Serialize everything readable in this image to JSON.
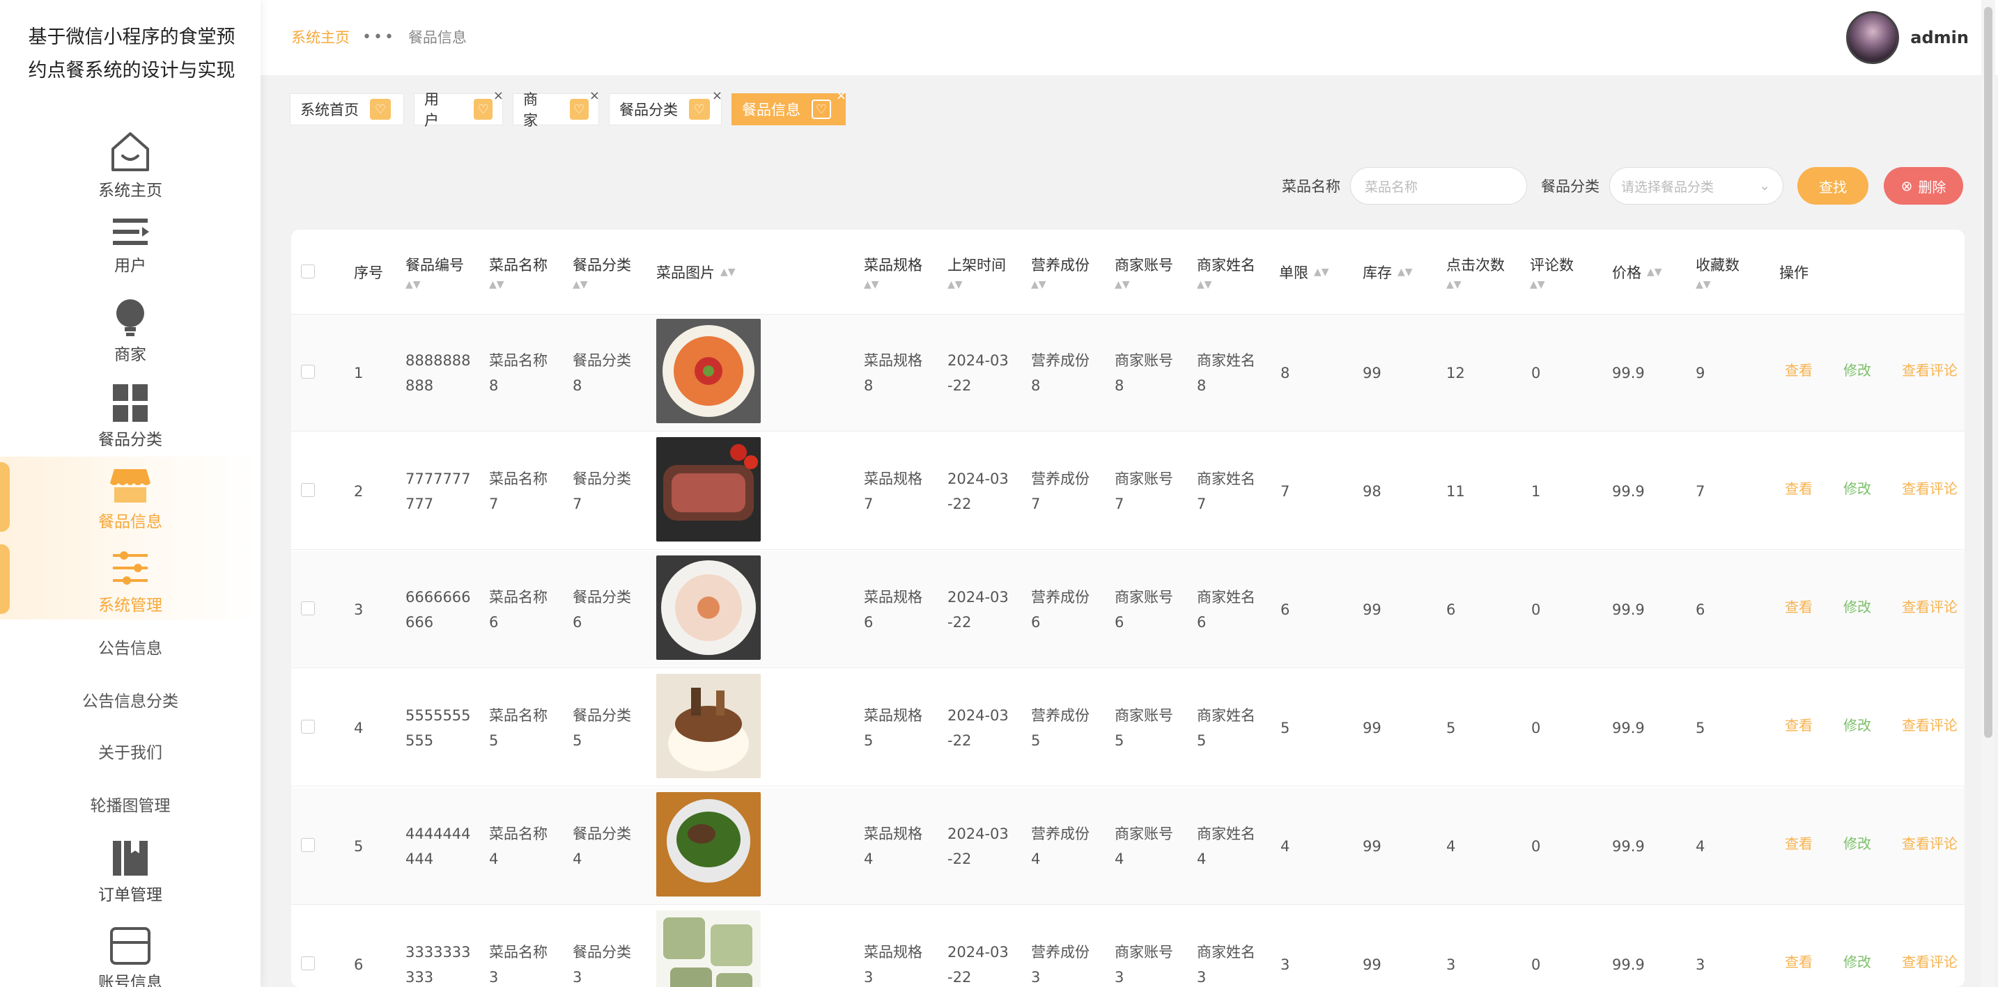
{
  "app": {
    "title": "基于微信小程序的食堂预约点餐系统的设计与实现"
  },
  "sidebar": {
    "items": [
      {
        "label": "系统主页",
        "icon": "home-icon"
      },
      {
        "label": "用户",
        "icon": "list-icon"
      },
      {
        "label": "商家",
        "icon": "bulb-icon"
      },
      {
        "label": "餐品分类",
        "icon": "grid-icon"
      },
      {
        "label": "餐品信息",
        "icon": "shop-icon"
      },
      {
        "label": "系统管理",
        "icon": "settings-sliders-icon"
      },
      {
        "label": "公告信息"
      },
      {
        "label": "公告信息分类"
      },
      {
        "label": "关于我们"
      },
      {
        "label": "轮播图管理"
      },
      {
        "label": "订单管理",
        "icon": "book-icon"
      },
      {
        "label": "账号信息",
        "icon": "card-icon"
      }
    ]
  },
  "header": {
    "breadcrumb_home": "系统主页",
    "breadcrumb_current": "餐品信息",
    "username": "admin"
  },
  "tabs": [
    {
      "label": "系统首页",
      "closable": false
    },
    {
      "label": "用户",
      "closable": true
    },
    {
      "label": "商家",
      "closable": true
    },
    {
      "label": "餐品分类",
      "closable": true
    },
    {
      "label": "餐品信息",
      "closable": true,
      "current": true
    }
  ],
  "search": {
    "name_label": "菜品名称",
    "name_placeholder": "菜品名称",
    "category_label": "餐品分类",
    "category_placeholder": "请选择餐品分类",
    "find_button": "查找",
    "delete_button": "删除"
  },
  "table": {
    "columns": [
      "序号",
      "餐品编号",
      "菜品名称",
      "餐品分类",
      "菜品图片",
      "菜品规格",
      "上架时间",
      "营养成份",
      "商家账号",
      "商家姓名",
      "单限",
      "库存",
      "点击次数",
      "评论数",
      "价格",
      "收藏数",
      "操作"
    ],
    "actions": {
      "view": "查看",
      "edit": "修改",
      "comments": "查看评论"
    },
    "rows": [
      {
        "idx": "1",
        "code1": "8888888",
        "code2": "888",
        "name1": "菜品名称",
        "name2": "8",
        "cat1": "餐品分类",
        "cat2": "8",
        "spec1": "菜品规格",
        "spec2": "8",
        "date1": "2024-03",
        "date2": "-22",
        "nut1": "营养成份",
        "nut2": "8",
        "acct1": "商家账号",
        "acct2": "8",
        "mname1": "商家姓名",
        "mname2": "8",
        "limit": "8",
        "stock": "99",
        "clicks": "12",
        "comments": "0",
        "price": "99.9",
        "favs": "9",
        "img": "shrimp-platter"
      },
      {
        "idx": "2",
        "code1": "7777777",
        "code2": "777",
        "name1": "菜品名称",
        "name2": "7",
        "cat1": "餐品分类",
        "cat2": "7",
        "spec1": "菜品规格",
        "spec2": "7",
        "date1": "2024-03",
        "date2": "-22",
        "nut1": "营养成份",
        "nut2": "7",
        "acct1": "商家账号",
        "acct2": "7",
        "mname1": "商家姓名",
        "mname2": "7",
        "limit": "7",
        "stock": "98",
        "clicks": "11",
        "comments": "1",
        "price": "99.9",
        "favs": "7",
        "img": "steak"
      },
      {
        "idx": "3",
        "code1": "6666666",
        "code2": "666",
        "name1": "菜品名称",
        "name2": "6",
        "cat1": "餐品分类",
        "cat2": "6",
        "spec1": "菜品规格",
        "spec2": "6",
        "date1": "2024-03",
        "date2": "-22",
        "nut1": "营养成份",
        "nut2": "6",
        "acct1": "商家账号",
        "acct2": "6",
        "mname1": "商家姓名",
        "mname2": "6",
        "limit": "6",
        "stock": "99",
        "clicks": "6",
        "comments": "0",
        "price": "99.9",
        "favs": "6",
        "img": "sashimi"
      },
      {
        "idx": "4",
        "code1": "5555555",
        "code2": "555",
        "name1": "菜品名称",
        "name2": "5",
        "cat1": "餐品分类",
        "cat2": "5",
        "spec1": "菜品规格",
        "spec2": "5",
        "date1": "2024-03",
        "date2": "-22",
        "nut1": "营养成份",
        "nut2": "5",
        "acct1": "商家账号",
        "acct2": "5",
        "mname1": "商家姓名",
        "mname2": "5",
        "limit": "5",
        "stock": "99",
        "clicks": "5",
        "comments": "0",
        "price": "99.9",
        "favs": "5",
        "img": "braised-pot"
      },
      {
        "idx": "5",
        "code1": "4444444",
        "code2": "444",
        "name1": "菜品名称",
        "name2": "4",
        "cat1": "餐品分类",
        "cat2": "4",
        "spec1": "菜品规格",
        "spec2": "4",
        "date1": "2024-03",
        "date2": "-22",
        "nut1": "营养成份",
        "nut2": "4",
        "acct1": "商家账号",
        "acct2": "4",
        "mname1": "商家姓名",
        "mname2": "4",
        "limit": "4",
        "stock": "99",
        "clicks": "4",
        "comments": "0",
        "price": "99.9",
        "favs": "4",
        "img": "greens"
      },
      {
        "idx": "6",
        "code1": "3333333",
        "code2": "333",
        "name1": "菜品名称",
        "name2": "3",
        "cat1": "餐品分类",
        "cat2": "3",
        "spec1": "菜品规格",
        "spec2": "3",
        "date1": "2024-03",
        "date2": "-22",
        "nut1": "营养成份",
        "nut2": "3",
        "acct1": "商家账号",
        "acct2": "3",
        "mname1": "商家姓名",
        "mname2": "3",
        "limit": "3",
        "stock": "99",
        "clicks": "3",
        "comments": "0",
        "price": "99.9",
        "favs": "3",
        "img": "pastries"
      }
    ]
  },
  "colors": {
    "accent": "#f7a83a",
    "edit": "#7cc06a",
    "danger": "#f0706a"
  }
}
